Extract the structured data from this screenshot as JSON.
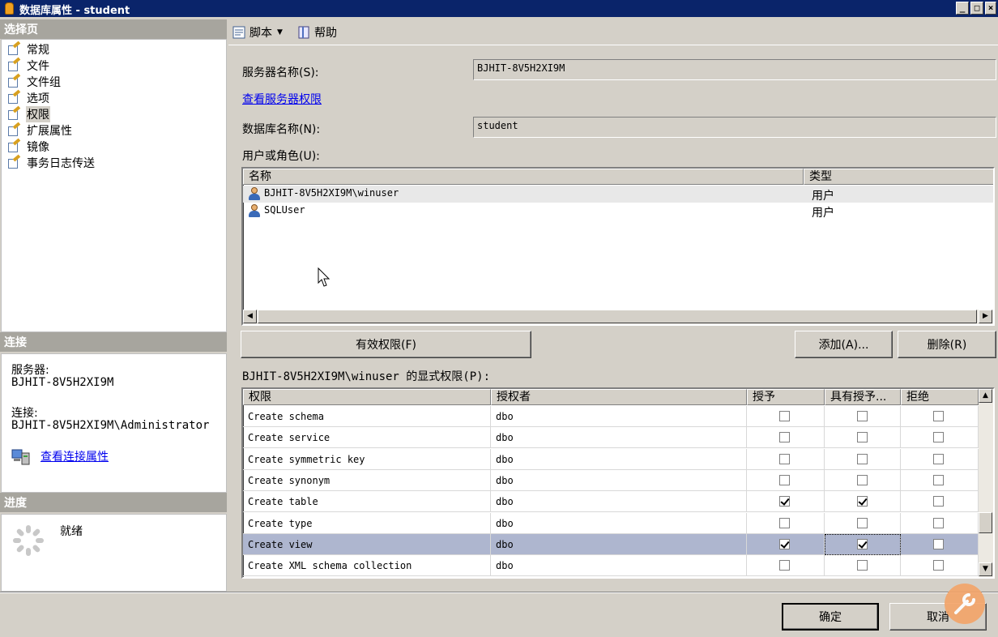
{
  "window": {
    "title": "数据库属性 - student",
    "buttons": [
      "_",
      "□",
      "×"
    ]
  },
  "left_panel": {
    "pages_header": "选择页",
    "pages": [
      {
        "label": "常规",
        "icon": "page-wrench-icon"
      },
      {
        "label": "文件",
        "icon": "page-wrench-icon"
      },
      {
        "label": "文件组",
        "icon": "page-wrench-icon"
      },
      {
        "label": "选项",
        "icon": "page-wrench-icon"
      },
      {
        "label": "权限",
        "icon": "page-wrench-icon",
        "selected": true
      },
      {
        "label": "扩展属性",
        "icon": "page-wrench-icon"
      },
      {
        "label": "镜像",
        "icon": "page-wrench-icon"
      },
      {
        "label": "事务日志传送",
        "icon": "page-wrench-icon"
      }
    ],
    "connection_header": "连接",
    "server_label": "服务器:",
    "server_value": "BJHIT-8V5H2XI9M",
    "connection_label": "连接:",
    "connection_value": "BJHIT-8V5H2XI9M\\Administrator",
    "view_connection_link": "查看连接属性",
    "progress_header": "进度",
    "progress_status": "就绪"
  },
  "toolbar": {
    "script_label": "脚本",
    "help_label": "帮助"
  },
  "form": {
    "server_name_label": "服务器名称(S):",
    "server_name_value": "BJHIT-8V5H2XI9M",
    "view_server_perms_link": "查看服务器权限",
    "db_name_label": "数据库名称(N):",
    "db_name_value": "student",
    "users_label": "用户或角色(U):"
  },
  "users_table": {
    "columns": [
      "名称",
      "类型"
    ],
    "rows": [
      {
        "name": "BJHIT-8V5H2XI9M\\winuser",
        "type": "用户",
        "selected": true
      },
      {
        "name": "SQLUser",
        "type": "用户"
      }
    ]
  },
  "buttons": {
    "effective_perms": "有效权限(F)",
    "add": "添加(A)...",
    "remove": "删除(R)",
    "ok": "确定",
    "cancel": "取消"
  },
  "perms_label": "BJHIT-8V5H2XI9M\\winuser 的显式权限(P):",
  "perms_table": {
    "columns": [
      "权限",
      "授权者",
      "授予",
      "具有授予...",
      "拒绝"
    ],
    "rows": [
      {
        "permission": "Create schema",
        "grantor": "dbo",
        "grant": false,
        "with_grant": false,
        "deny": false
      },
      {
        "permission": "Create service",
        "grantor": "dbo",
        "grant": false,
        "with_grant": false,
        "deny": false
      },
      {
        "permission": "Create symmetric key",
        "grantor": "dbo",
        "grant": false,
        "with_grant": false,
        "deny": false
      },
      {
        "permission": "Create synonym",
        "grantor": "dbo",
        "grant": false,
        "with_grant": false,
        "deny": false
      },
      {
        "permission": "Create table",
        "grantor": "dbo",
        "grant": true,
        "with_grant": true,
        "deny": false
      },
      {
        "permission": "Create type",
        "grantor": "dbo",
        "grant": false,
        "with_grant": false,
        "deny": false
      },
      {
        "permission": "Create view",
        "grantor": "dbo",
        "grant": true,
        "with_grant": true,
        "deny": false,
        "selected": true
      },
      {
        "permission": "Create XML schema collection",
        "grantor": "dbo",
        "grant": false,
        "with_grant": false,
        "deny": false
      }
    ]
  }
}
